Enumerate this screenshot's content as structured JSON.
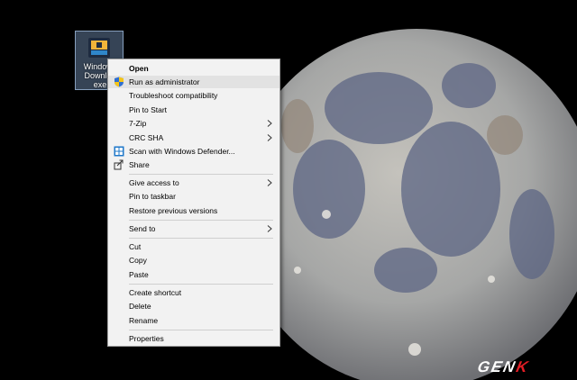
{
  "desktop_icon": {
    "label_lines": [
      "Windows",
      "Downloa",
      "exe"
    ],
    "icon": "app-installer-icon"
  },
  "context_menu": {
    "items": [
      {
        "label": "Open",
        "bold": true
      },
      {
        "label": "Run as administrator",
        "icon": "uac-shield-icon",
        "highlighted": true
      },
      {
        "label": "Troubleshoot compatibility"
      },
      {
        "label": "Pin to Start"
      },
      {
        "label": "7-Zip",
        "submenu": true
      },
      {
        "label": "CRC SHA",
        "submenu": true
      },
      {
        "label": "Scan with Windows Defender...",
        "icon": "windows-defender-icon"
      },
      {
        "label": "Share",
        "icon": "share-icon"
      },
      {
        "label": "Give access to",
        "submenu": true
      },
      {
        "label": "Pin to taskbar"
      },
      {
        "label": "Restore previous versions"
      },
      {
        "label": "Send to",
        "submenu": true
      },
      {
        "label": "Cut"
      },
      {
        "label": "Copy"
      },
      {
        "label": "Paste"
      },
      {
        "label": "Create shortcut"
      },
      {
        "label": "Delete"
      },
      {
        "label": "Rename"
      },
      {
        "label": "Properties"
      }
    ]
  },
  "watermark": {
    "text_main": "GEN",
    "text_accent": "K"
  },
  "colors": {
    "menu_bg": "#f2f2f2",
    "menu_highlight": "#e2e2e2",
    "logo_accent": "#e21d25"
  }
}
